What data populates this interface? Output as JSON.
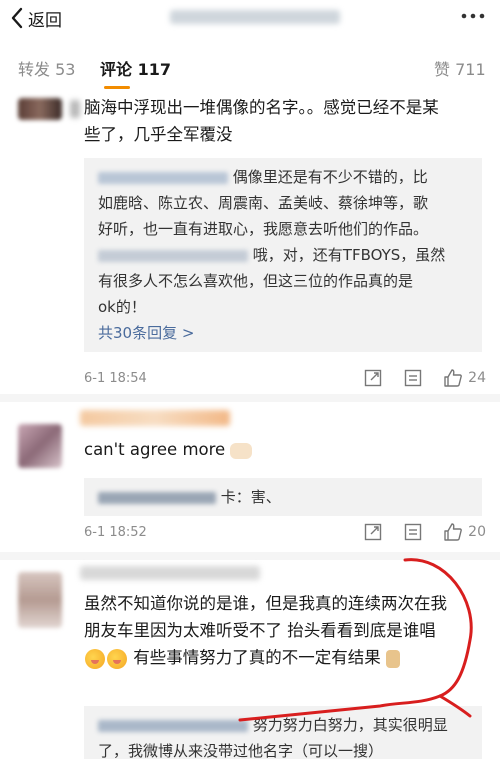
{
  "nav": {
    "back_label": "返回",
    "back_icon": "chevron-left-icon",
    "more_icon": "ellipsis-icon"
  },
  "tabs": {
    "repost_label": "转发",
    "repost_count": "53",
    "comment_label": "评论",
    "comment_count": "117",
    "like_label": "赞",
    "like_count": "711",
    "accent": "#f28c00"
  },
  "comments": [
    {
      "text_line1": "脑海中浮现出一堆偶像的名字。。感觉已经不是某",
      "text_line2": "些了，几乎全军覆没",
      "replies_line1": "偶像里还是有不少不错的，比",
      "replies_line2": "如鹿晗、陈立农、周震南、孟美岐、蔡徐坤等，歌",
      "replies_line3": "好听，也一直有进取心，我愿意去听他们的作品。",
      "replies_line4": "哦，对，还有TFBOYS，虽然",
      "replies_line5": "有很多人不怎么喜欢他，但这三位的作品真的是",
      "replies_line6": "ok的！",
      "more_replies": "共30条回复 >",
      "time": "6-1 18:54",
      "likes": "24"
    },
    {
      "text": "can't agree more",
      "reply": "卡：害、",
      "time": "6-1 18:52",
      "likes": "20"
    },
    {
      "text_line1": "虽然不知道你说的是谁，但是我真的连续两次在我",
      "text_line2": "朋友车里因为太难听受不了 抬头看看到底是谁唱",
      "text_line3": "有些事情努力了真的不一定有结果",
      "reply_line1": "努力努力白努力，其实很明显",
      "reply_line2": "了，我微博从来没带过他名字（可以一搜）"
    }
  ],
  "colors": {
    "link": "#4a6b9c",
    "meta": "#8c8c8c",
    "annotation": "#d81e1e"
  }
}
